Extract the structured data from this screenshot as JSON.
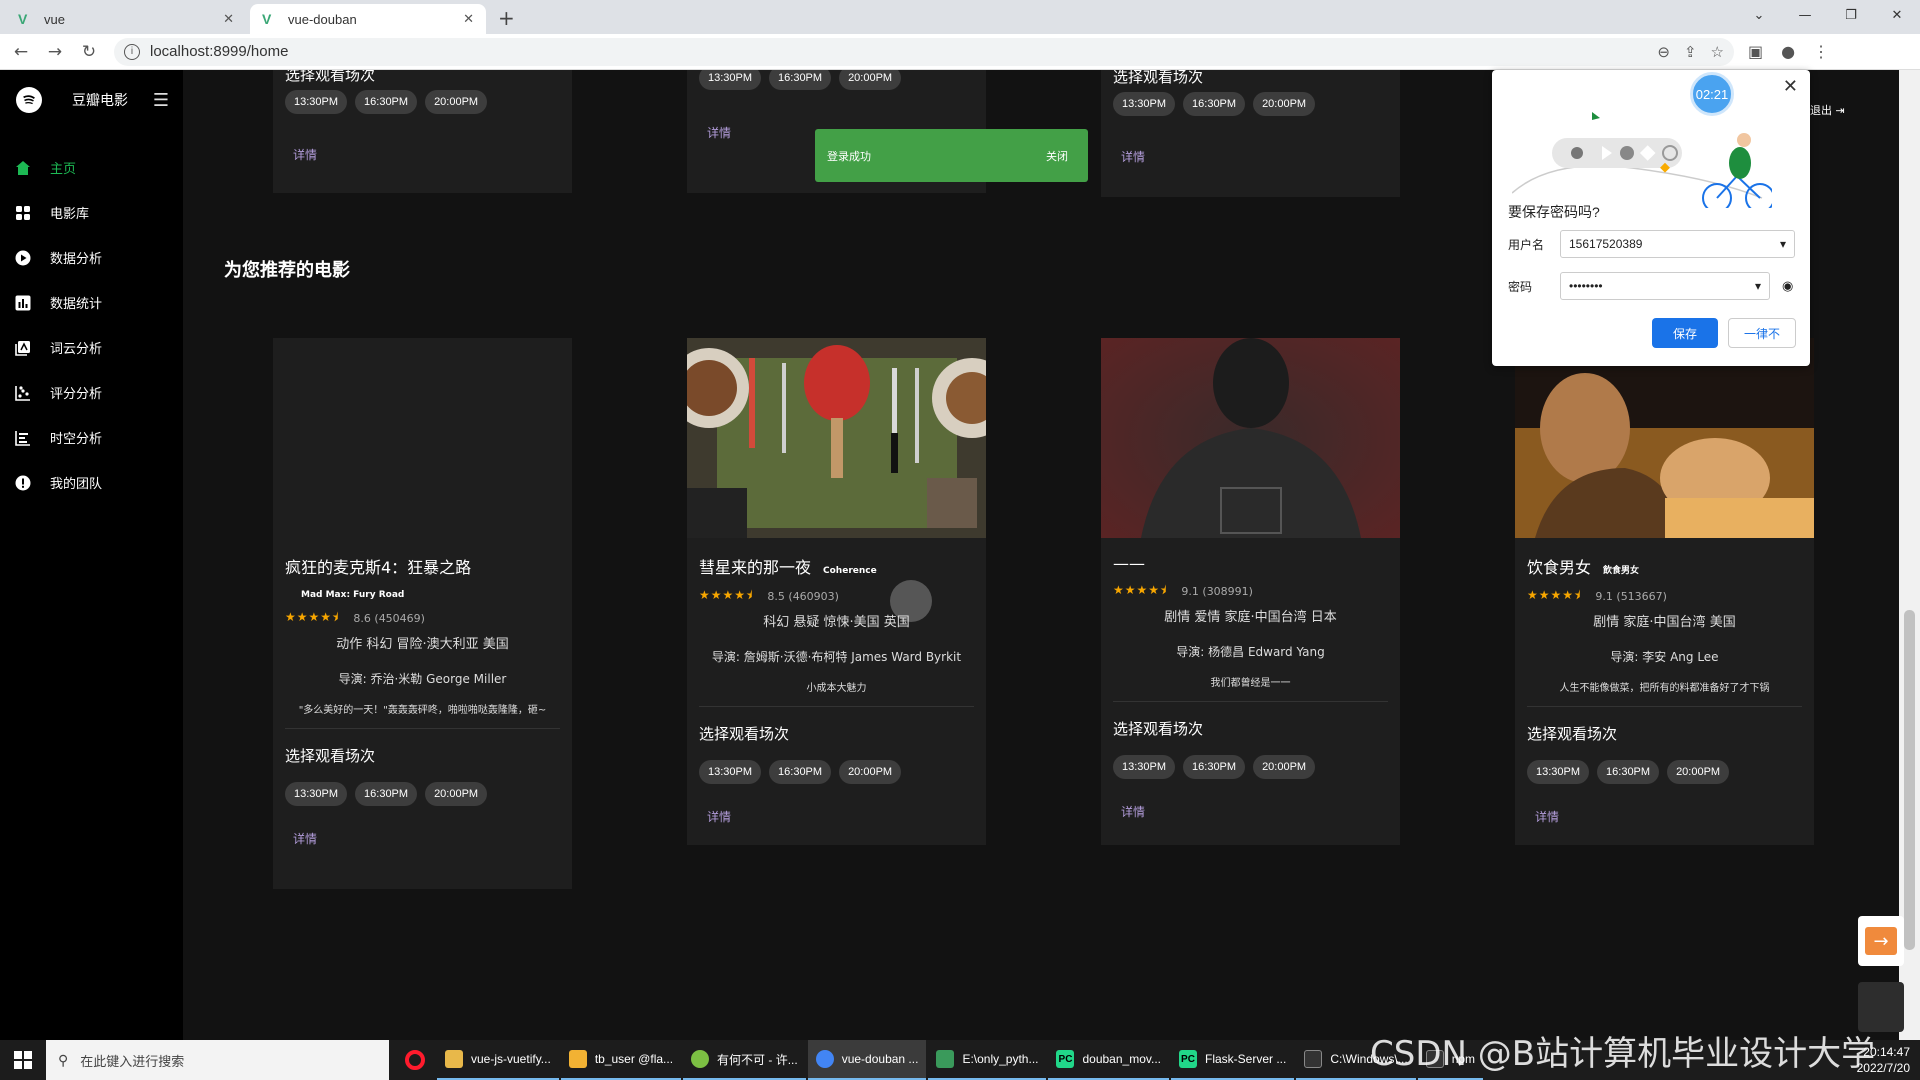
{
  "browser": {
    "tabs": [
      {
        "title": "vue"
      },
      {
        "title": "vue-douban"
      }
    ],
    "url": "localhost:8999/home"
  },
  "sidebar": {
    "brand": "豆瓣电影",
    "items": [
      {
        "label": "主页",
        "icon": "home-icon",
        "active": true
      },
      {
        "label": "电影库",
        "icon": "grid-icon"
      },
      {
        "label": "数据分析",
        "icon": "play-circle-icon"
      },
      {
        "label": "数据统计",
        "icon": "bar-chart-icon"
      },
      {
        "label": "词云分析",
        "icon": "wordcloud-icon"
      },
      {
        "label": "评分分析",
        "icon": "scatter-icon"
      },
      {
        "label": "时空分析",
        "icon": "timeline-icon"
      },
      {
        "label": "我的团队",
        "icon": "info-circle-icon"
      }
    ]
  },
  "top_cards": [
    {
      "section": "选择观看场次",
      "times": [
        "13:30PM",
        "16:30PM",
        "20:00PM"
      ],
      "detail": "详情"
    },
    {
      "times": [
        "13:30PM",
        "16:30PM",
        "20:00PM"
      ],
      "detail": "详情"
    },
    {
      "section": "选择观看场次",
      "times": [
        "13:30PM",
        "16:30PM",
        "20:00PM"
      ],
      "detail": "详情"
    }
  ],
  "toast": {
    "message": "登录成功",
    "close": "关闭"
  },
  "recommend_title": "为您推荐的电影",
  "movies": [
    {
      "title": "疯狂的麦克斯4：狂暴之路",
      "subtitle": "Mad Max: Fury Road",
      "rating": 4.3,
      "score": "8.6 (450469)",
      "genre": "动作 科幻 冒险·澳大利亚 美国",
      "director": "导演: 乔治·米勒 George Miller",
      "quote": "\"多么美好的一天！\"轰轰轰砰咚，啪啦啪哒轰隆隆，砸~",
      "section": "选择观看场次",
      "times": [
        "13:30PM",
        "16:30PM",
        "20:00PM"
      ],
      "detail": "详情"
    },
    {
      "title": "彗星来的那一夜",
      "subtitle": "Coherence",
      "rating": 4.3,
      "score": "8.5 (460903)",
      "genre": "科幻 悬疑 惊悚·美国 英国",
      "director": "导演: 詹姆斯·沃德·布柯特 James Ward Byrkit",
      "quote": "小成本大魅力",
      "section": "选择观看场次",
      "times": [
        "13:30PM",
        "16:30PM",
        "20:00PM"
      ],
      "detail": "详情"
    },
    {
      "title": "——",
      "subtitle": "",
      "rating": 4.5,
      "score": "9.1 (308991)",
      "genre": "剧情 爱情 家庭·中国台湾 日本",
      "director": "导演: 杨德昌 Edward Yang",
      "quote": "我们都曾经是一一",
      "section": "选择观看场次",
      "times": [
        "13:30PM",
        "16:30PM",
        "20:00PM"
      ],
      "detail": "详情"
    },
    {
      "title": "饮食男女",
      "subtitle": "飲食男女",
      "rating": 4.5,
      "score": "9.1 (513667)",
      "genre": "剧情 家庭·中国台湾 美国",
      "director": "导演: 李安 Ang Lee",
      "quote": "人生不能像做菜，把所有的料都准备好了才下锅",
      "section": "选择观看场次",
      "times": [
        "13:30PM",
        "16:30PM",
        "20:00PM"
      ],
      "detail": "详情"
    }
  ],
  "password_dialog": {
    "timer": "02:21",
    "question": "要保存密码吗?",
    "username_label": "用户名",
    "username_value": "15617520389",
    "password_label": "密码",
    "password_value": "••••••••",
    "save": "保存",
    "never": "一律不"
  },
  "logout": "退出",
  "taskbar": {
    "search_placeholder": "在此键入进行搜索",
    "apps": [
      {
        "label": "vue-js-vuetify...",
        "color": "#e8b84a"
      },
      {
        "label": "tb_user @fla...",
        "color": "#f2b233"
      },
      {
        "label": "有何不可 - 许...",
        "color": "#7cc043"
      },
      {
        "label": "vue-douban ...",
        "color": "#4285f4",
        "active": true
      },
      {
        "label": "E:\\only_pyth...",
        "color": "#3a9a5b"
      },
      {
        "label": "douban_mov...",
        "color": "#21d789"
      },
      {
        "label": "Flask-Server ...",
        "color": "#21d789"
      },
      {
        "label": "C:\\Windows\\...",
        "color": "#333333"
      },
      {
        "label": "npm",
        "color": "#333333"
      }
    ],
    "time": "20:14:47",
    "date": "2022/7/20"
  },
  "watermark": "CSDN @B站计算机毕业设计大学"
}
